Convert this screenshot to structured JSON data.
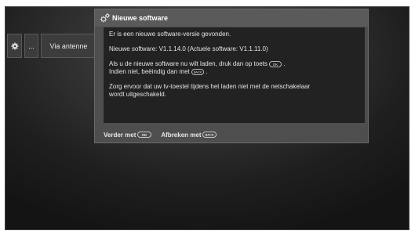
{
  "menu": {
    "gear_icon": "gear-icon",
    "dots_label": "...",
    "source_label": "Via antenne"
  },
  "dialog": {
    "icon": "gears-icon",
    "title": "Nieuwe software",
    "line1": "Er is een nieuwe software-versie gevonden.",
    "line2": "Nieuwe software:  V1.1.14.0   (Actuele software:  V1.1.11.0)",
    "line3a": "Als u de nieuwe software nu wilt laden, druk dan op toets",
    "line3a_end": ".",
    "line3b": "Indien niet, beëindig dan met",
    "line3b_end": ".",
    "line4a": "Zorg ervoor dat uw tv-toestel tijdens het laden niet met de netschakelaar",
    "line4b": "wordt uitgeschakeld.",
    "ok_key_label": "OK",
    "back_key_label": "BACK"
  },
  "footer": {
    "continue_label": "Verder met",
    "cancel_label": "Afbreken met"
  },
  "colors": {
    "background": "#1f1f1f",
    "dialog": "#4e4e4e",
    "panel": "#222222",
    "text": "#e4e4e4"
  }
}
